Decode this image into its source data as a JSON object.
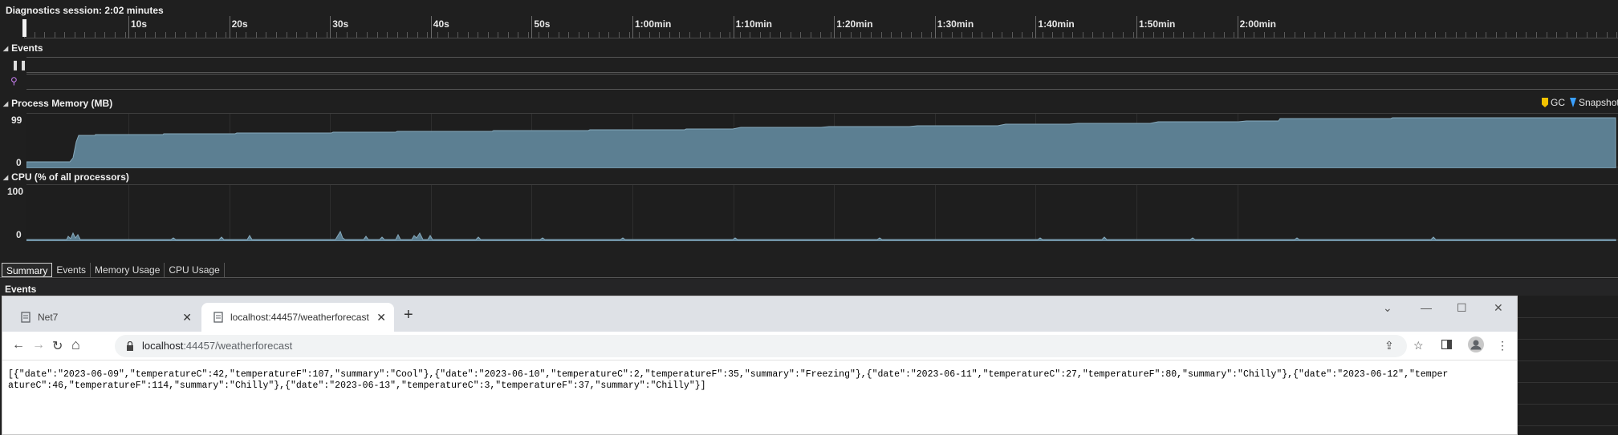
{
  "session": {
    "title": "Diagnostics session: 2:02 minutes"
  },
  "ruler": {
    "labels": [
      "10s",
      "20s",
      "30s",
      "40s",
      "50s",
      "1:00min",
      "1:10min",
      "1:20min",
      "1:30min",
      "1:40min",
      "1:50min",
      "2:00min"
    ]
  },
  "sections": {
    "events": "Events",
    "memory": "Process Memory (MB)",
    "cpu": "CPU (% of all processors)"
  },
  "memory": {
    "max": "99",
    "min": "0"
  },
  "cpu": {
    "max": "100",
    "min": "0"
  },
  "legend": {
    "gc": "GC",
    "snapshot": "Snapshot",
    "gc_color": "#f2c200",
    "snapshot_color": "#3aa0ff"
  },
  "colors": {
    "chart_fill": "#5c7f92",
    "chart_line": "#86a9bc"
  },
  "bottom_tabs": [
    "Summary",
    "Events",
    "Memory Usage",
    "CPU Usage"
  ],
  "events_panel_label": "Events",
  "browser": {
    "tabs": [
      {
        "label": "Net7"
      },
      {
        "label": "localhost:44457/weatherforecast"
      }
    ],
    "url_host": "localhost",
    "url_rest": ":44457/weatherforecast",
    "content": "[{\"date\":\"2023-06-09\",\"temperatureC\":42,\"temperatureF\":107,\"summary\":\"Cool\"},{\"date\":\"2023-06-10\",\"temperatureC\":2,\"temperatureF\":35,\"summary\":\"Freezing\"},{\"date\":\"2023-06-11\",\"temperatureC\":27,\"temperatureF\":80,\"summary\":\"Chilly\"},{\"date\":\"2023-06-12\",\"temperatureC\":46,\"temperatureF\":114,\"summary\":\"Chilly\"},{\"date\":\"2023-06-13\",\"temperatureC\":3,\"temperatureF\":37,\"summary\":\"Chilly\"}]"
  }
}
